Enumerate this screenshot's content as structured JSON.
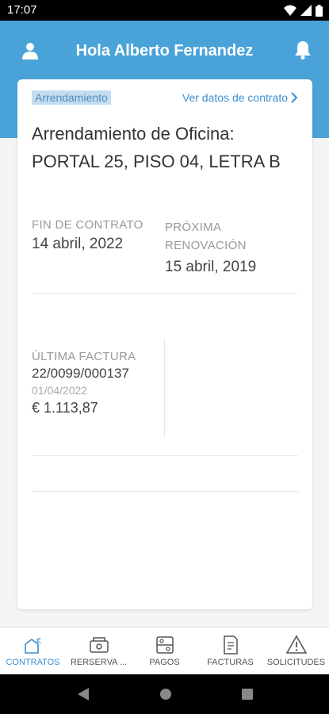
{
  "status_bar": {
    "time": "17:07"
  },
  "header": {
    "greeting": "Hola Alberto Fernandez"
  },
  "card": {
    "tag": "Arrendamiento",
    "link": "Ver datos de contrato",
    "title": "Arrendamiento de Oficina: PORTAL 25, PISO 04, LETRA B",
    "fin_contrato": {
      "label": "FIN DE CONTRATO",
      "value": "14 abril, 2022"
    },
    "proxima_renovacion": {
      "label": "PRÓXIMA RENOVACIÓN",
      "value": "15 abril, 2019"
    },
    "ultima_factura": {
      "label": "ÚLTIMA FACTURA",
      "number": "22/0099/000137",
      "date": "01/04/2022",
      "amount": "€ 1.113,87"
    }
  },
  "bottom_nav": {
    "items": [
      {
        "label": "CONTRATOS",
        "icon": "contracts-icon"
      },
      {
        "label": "RERSERVA ...",
        "icon": "reservation-icon"
      },
      {
        "label": "PAGOS",
        "icon": "payments-icon"
      },
      {
        "label": "FACTURAS",
        "icon": "invoices-icon"
      },
      {
        "label": "SOLICITUDES",
        "icon": "requests-icon"
      }
    ]
  },
  "colors": {
    "primary": "#4aa3d8",
    "accent": "#3a8fd2"
  }
}
